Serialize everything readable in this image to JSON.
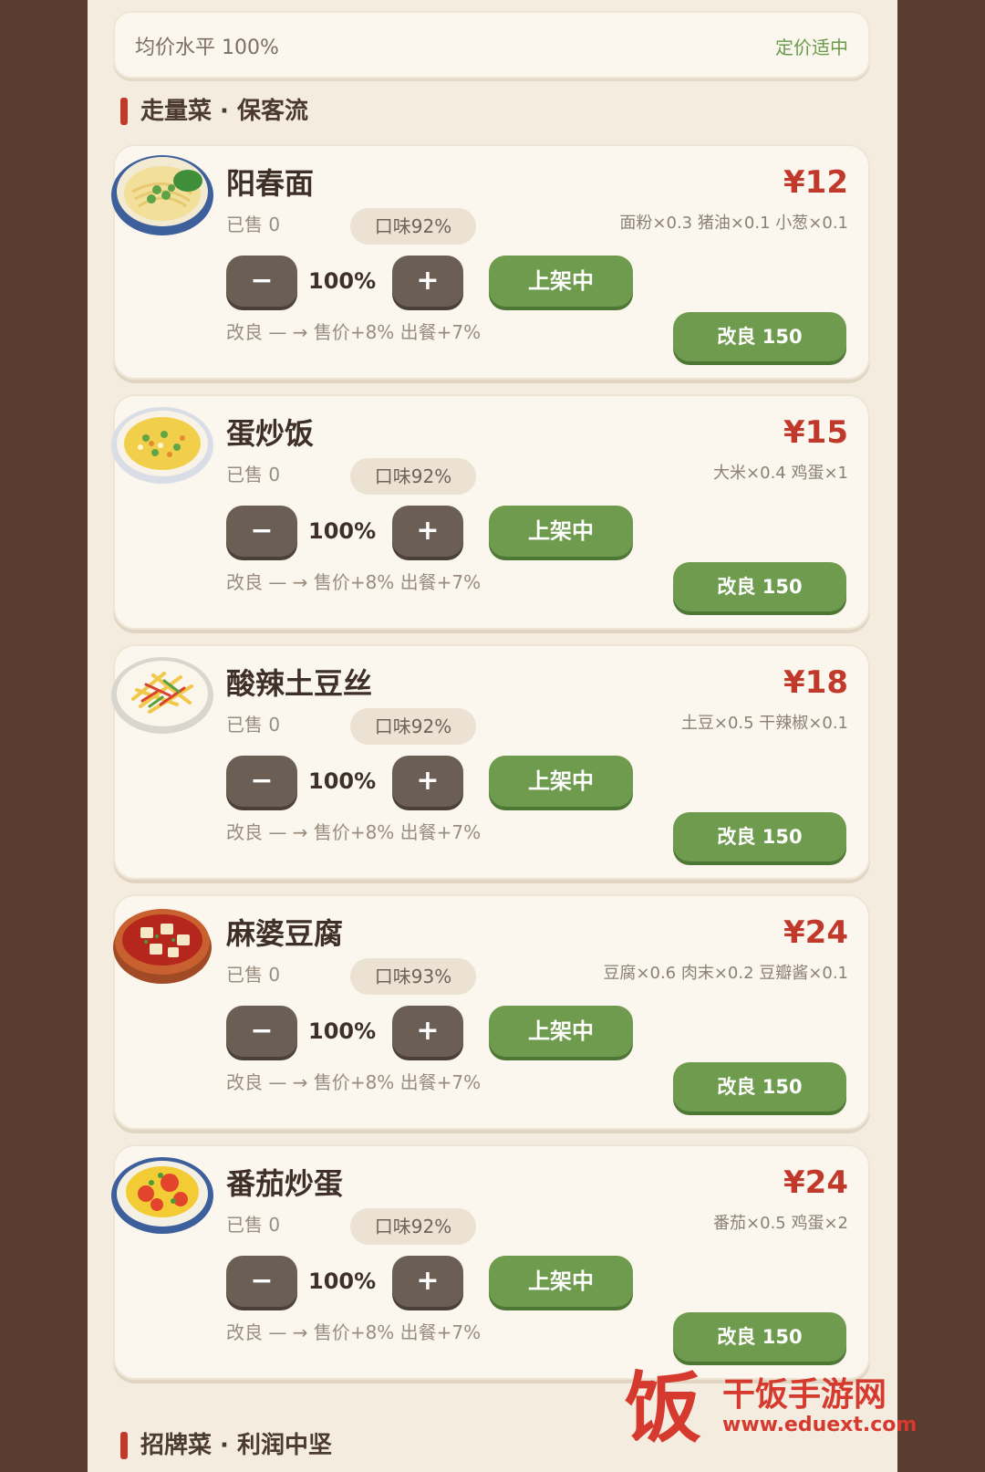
{
  "price_level": {
    "label": "均价水平 100%",
    "status": "定价适中"
  },
  "sections": [
    {
      "title": "走量菜 · 保客流"
    },
    {
      "title": "招牌菜 · 利润中坚"
    }
  ],
  "dishes": [
    {
      "name": "阳春面",
      "sold": "已售 0",
      "taste": "口味92%",
      "price": "¥12",
      "ingredients": "面粉×0.3   猪油×0.1   小葱×0.1",
      "minus": "−",
      "percent": "100%",
      "plus": "+",
      "status": "上架中",
      "improve_note": "改良 — → 售价+8% 出餐+7%",
      "improve_button": "改良 150",
      "icon": "noodle-bowl-icon"
    },
    {
      "name": "蛋炒饭",
      "sold": "已售 0",
      "taste": "口味92%",
      "price": "¥15",
      "ingredients": "大米×0.4   鸡蛋×1",
      "minus": "−",
      "percent": "100%",
      "plus": "+",
      "status": "上架中",
      "improve_note": "改良 — → 售价+8% 出餐+7%",
      "improve_button": "改良 150",
      "icon": "fried-rice-icon"
    },
    {
      "name": "酸辣土豆丝",
      "sold": "已售 0",
      "taste": "口味92%",
      "price": "¥18",
      "ingredients": "土豆×0.5   干辣椒×0.1",
      "minus": "−",
      "percent": "100%",
      "plus": "+",
      "status": "上架中",
      "improve_note": "改良 — → 售价+8% 出餐+7%",
      "improve_button": "改良 150",
      "icon": "potato-strips-icon"
    },
    {
      "name": "麻婆豆腐",
      "sold": "已售 0",
      "taste": "口味93%",
      "price": "¥24",
      "ingredients": "豆腐×0.6   肉末×0.2   豆瓣酱×0.1",
      "minus": "−",
      "percent": "100%",
      "plus": "+",
      "status": "上架中",
      "improve_note": "改良 — → 售价+8% 出餐+7%",
      "improve_button": "改良 150",
      "icon": "mapo-tofu-icon"
    },
    {
      "name": "番茄炒蛋",
      "sold": "已售 0",
      "taste": "口味92%",
      "price": "¥24",
      "ingredients": "番茄×0.5   鸡蛋×2",
      "minus": "−",
      "percent": "100%",
      "plus": "+",
      "status": "上架中",
      "improve_note": "改良 — → 售价+8% 出餐+7%",
      "improve_button": "改良 150",
      "icon": "tomato-egg-icon"
    }
  ],
  "watermark": {
    "char": "饭",
    "name": "干饭手游网",
    "url": "www.eduext.com"
  },
  "colors": {
    "accent_red": "#c0392b",
    "green": "#6f9b4f",
    "dark_button": "#6b5e54"
  }
}
